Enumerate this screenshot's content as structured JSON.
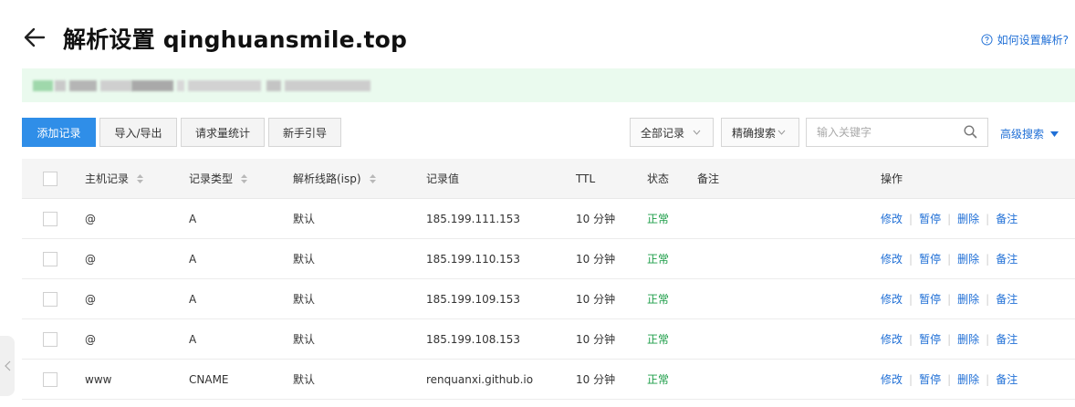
{
  "header": {
    "title": "解析设置 qinghuansmile.top",
    "help_text": "如何设置解析?"
  },
  "toolbar": {
    "add_record": "添加记录",
    "import_export": "导入/导出",
    "request_stats": "请求量统计",
    "beginner_guide": "新手引导",
    "record_filter": "全部记录",
    "search_mode": "精确搜索",
    "search_placeholder": "输入关键字",
    "search_value": "",
    "advanced_search": "高级搜索"
  },
  "table": {
    "headers": {
      "host": "主机记录",
      "type": "记录类型",
      "line": "解析线路(isp)",
      "value": "记录值",
      "ttl": "TTL",
      "status": "状态",
      "remark": "备注",
      "actions": "操作"
    },
    "action_labels": {
      "edit": "修改",
      "pause": "暂停",
      "delete": "删除",
      "remark": "备注"
    },
    "rows": [
      {
        "host": "@",
        "type": "A",
        "line": "默认",
        "value": "185.199.111.153",
        "ttl": "10 分钟",
        "status": "正常",
        "remark": ""
      },
      {
        "host": "@",
        "type": "A",
        "line": "默认",
        "value": "185.199.110.153",
        "ttl": "10 分钟",
        "status": "正常",
        "remark": ""
      },
      {
        "host": "@",
        "type": "A",
        "line": "默认",
        "value": "185.199.109.153",
        "ttl": "10 分钟",
        "status": "正常",
        "remark": ""
      },
      {
        "host": "@",
        "type": "A",
        "line": "默认",
        "value": "185.199.108.153",
        "ttl": "10 分钟",
        "status": "正常",
        "remark": ""
      },
      {
        "host": "www",
        "type": "CNAME",
        "line": "默认",
        "value": "renquanxi.github.io",
        "ttl": "10 分钟",
        "status": "正常",
        "remark": ""
      }
    ]
  },
  "colors": {
    "primary": "#2f8ee8",
    "link": "#1f6fd6",
    "status_ok": "#1a9c46",
    "banner_bg": "#eafaee"
  },
  "icons": {
    "back": "arrow-left-icon",
    "help": "question-circle-icon",
    "search": "magnifier-icon",
    "sort": "sort-updown-icon",
    "dropdown": "chevron-down-icon",
    "collapse": "chevron-left-icon"
  }
}
